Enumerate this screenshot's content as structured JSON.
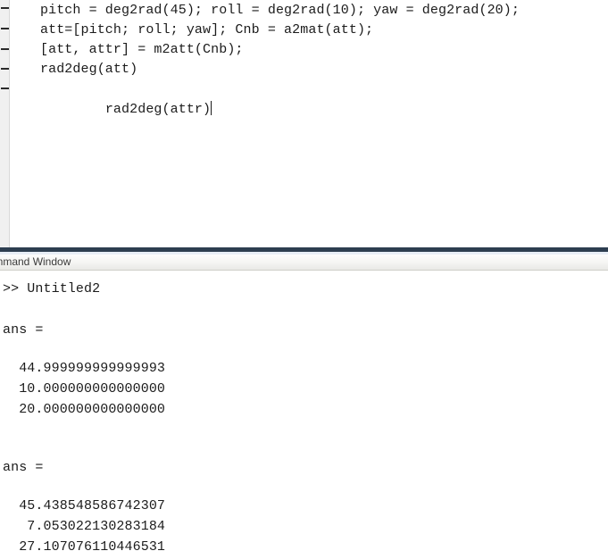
{
  "editor": {
    "name": "editor-pane",
    "gutter": {
      "fold_markers": [
        "-",
        "-",
        "-",
        "-",
        "-"
      ]
    },
    "code_lines": [
      "pitch = deg2rad(45); roll = deg2rad(10); yaw = deg2rad(20);",
      "att=[pitch; roll; yaw]; Cnb = a2mat(att);",
      "[att, attr] = m2att(Cnb);",
      "rad2deg(att)",
      "rad2deg(attr)"
    ],
    "caret_line_index": 4
  },
  "command_window": {
    "title": "mmand Window",
    "full_title": "Command Window",
    "lines": [
      ">> Untitled2",
      "",
      "ans =",
      "",
      "  44.999999999999993",
      "  10.000000000000000",
      "  20.000000000000000",
      "",
      "",
      "ans =",
      "",
      "  45.438548586742307",
      "   7.053022130283184",
      "  27.107076110446531"
    ],
    "prompt": ">> Untitled2",
    "result_blocks": [
      {
        "label": "ans =",
        "values": [
          "44.999999999999993",
          "10.000000000000000",
          "20.000000000000000"
        ]
      },
      {
        "label": "ans =",
        "values": [
          "45.438548586742307",
          "7.053022130283184",
          "27.107076110446531"
        ]
      }
    ]
  },
  "colors": {
    "splitter": "#2d3e50",
    "gutter_bg": "#f0f0f0",
    "text": "#1b1b1b",
    "titlebar_text": "#3b3b3b",
    "background": "#ffffff"
  }
}
